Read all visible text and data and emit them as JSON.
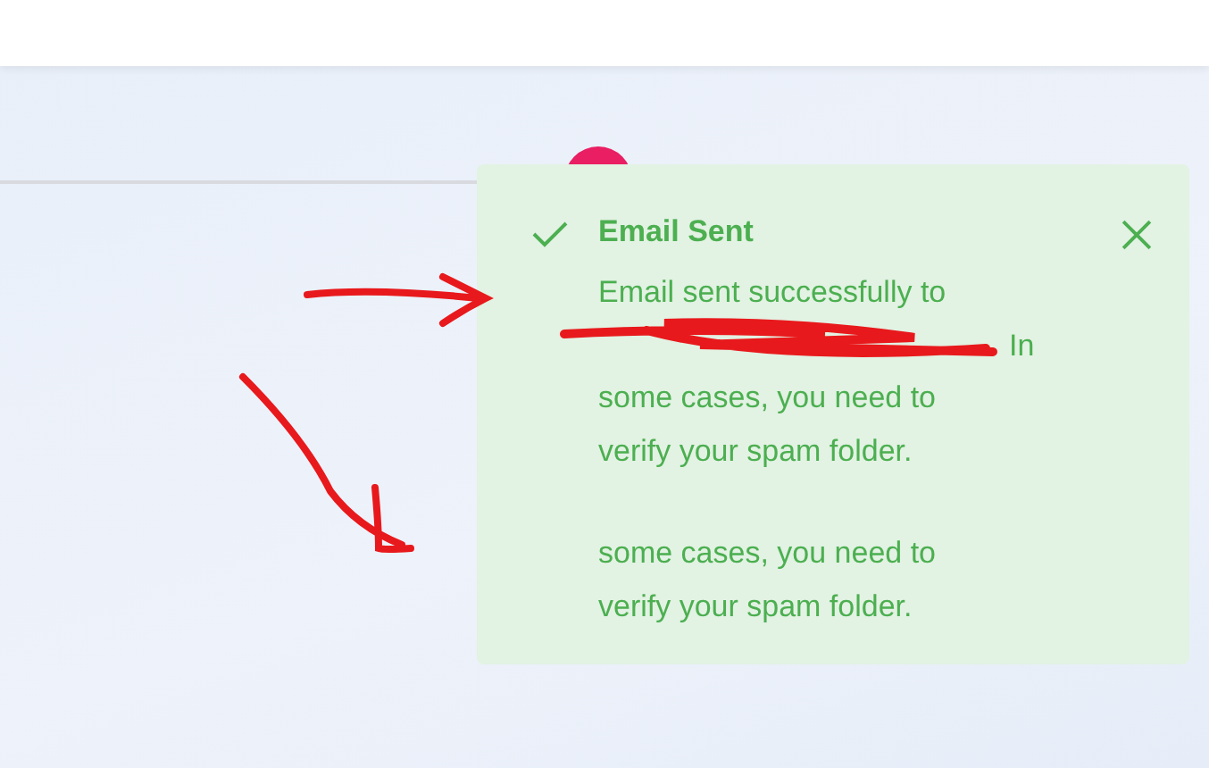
{
  "toasts": [
    {
      "kind": "success",
      "title": "Email Sent",
      "closable": true,
      "lines": [
        "Email sent successfully to"
      ],
      "redacted_tail": "In",
      "more_lines": [
        "some cases, you need to",
        "verify your spam folder."
      ]
    },
    {
      "kind": "success",
      "closable": false,
      "more_lines": [
        "some cases, you need to",
        "verify your spam folder."
      ]
    }
  ],
  "annotations": [
    {
      "kind": "arrow"
    },
    {
      "kind": "arrow"
    },
    {
      "kind": "scribble"
    }
  ]
}
